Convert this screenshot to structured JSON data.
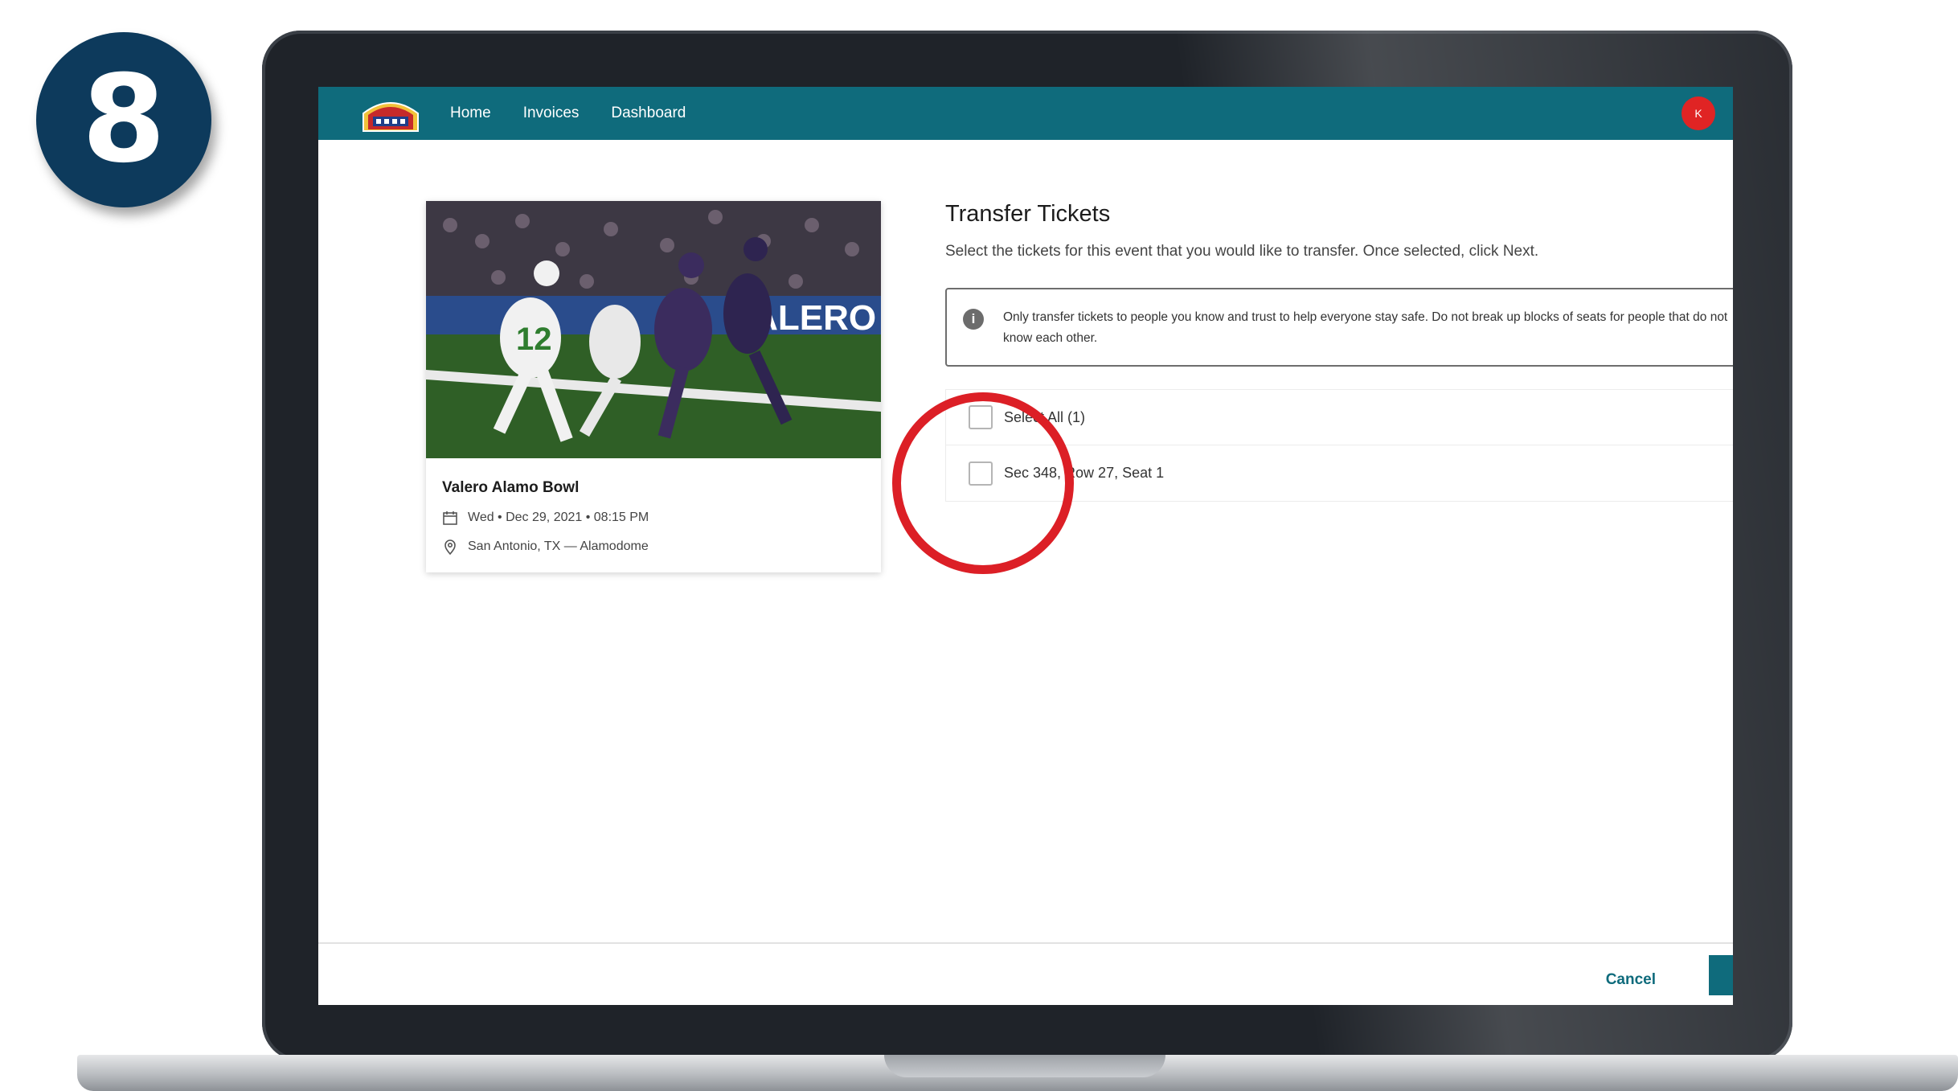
{
  "step": {
    "number": "8"
  },
  "navbar": {
    "items": [
      {
        "label": "Home"
      },
      {
        "label": "Invoices"
      },
      {
        "label": "Dashboard"
      }
    ],
    "avatar_initial": "K"
  },
  "event": {
    "title": "Valero Alamo Bowl",
    "datetime": "Wed • Dec 29, 2021 • 08:15 PM",
    "location": "San Antonio, TX — Alamodome",
    "image_banner_text": "VALERO",
    "player_number": "12"
  },
  "transfer": {
    "title": "Transfer Tickets",
    "subtitle": "Select the tickets for this event that you would like to transfer. Once selected, click Next.",
    "info_text": "Only transfer tickets to people you know and trust to help everyone stay safe. Do not break up blocks of seats for people that do not know each other.",
    "select_all_label": "Select All (1)",
    "tickets": [
      {
        "label": "Sec 348, Row 27, Seat 1"
      }
    ]
  },
  "footer": {
    "cancel_label": "Cancel"
  },
  "colors": {
    "brand_teal": "#0f6b7c",
    "badge_navy": "#0d3a5c",
    "annotation_red": "#dc1f26",
    "avatar_red": "#e02424"
  }
}
